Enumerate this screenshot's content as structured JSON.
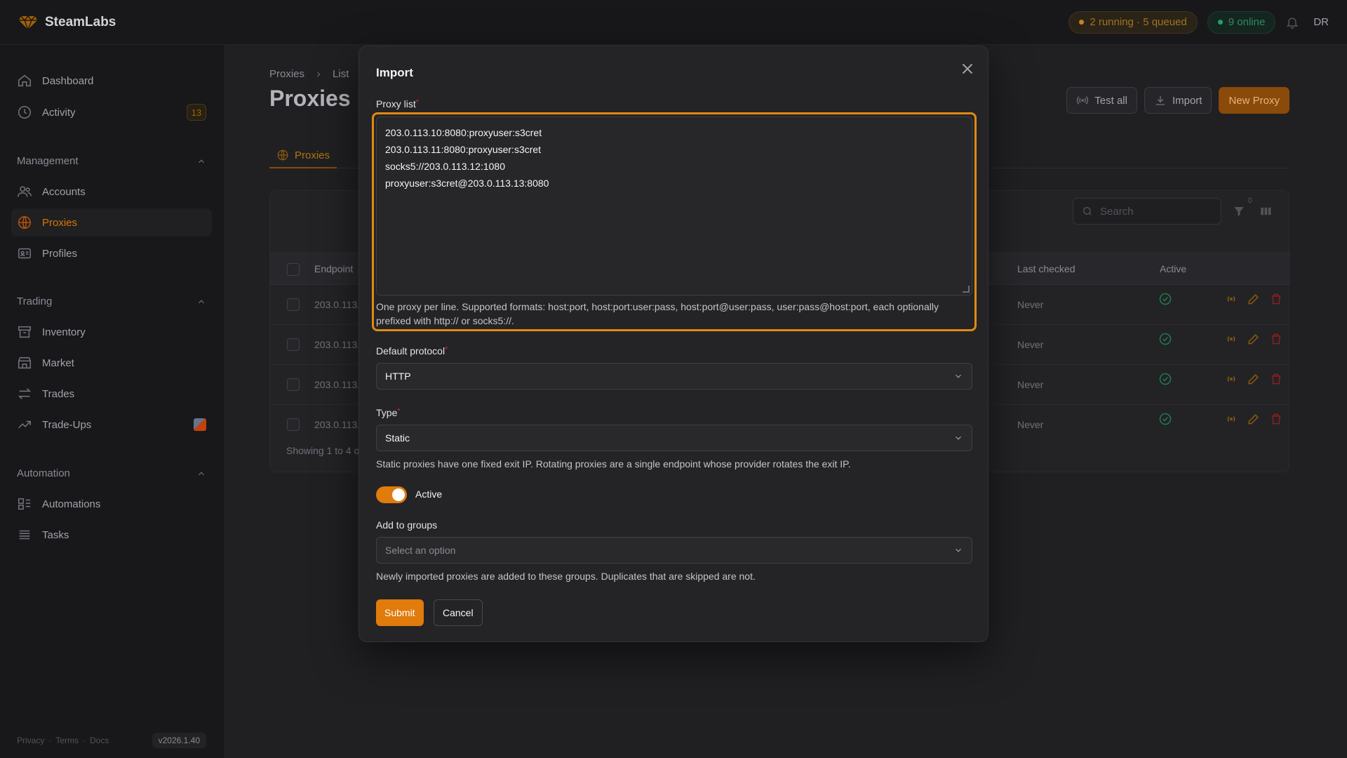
{
  "app": {
    "name": "SteamLabs"
  },
  "topbar": {
    "jobs_status": "2 running · 5 queued",
    "online_status": "9 online",
    "user_initials": "DR",
    "colors": {
      "running": "#c2851e",
      "online": "#22a06b"
    }
  },
  "sidebar": {
    "top": [
      {
        "label": "Dashboard",
        "icon": "home-icon"
      },
      {
        "label": "Activity",
        "icon": "clock-icon",
        "badge": "13"
      }
    ],
    "groups": [
      {
        "title": "Management",
        "items": [
          {
            "label": "Accounts",
            "icon": "users-icon"
          },
          {
            "label": "Proxies",
            "icon": "globe-icon",
            "active": true
          },
          {
            "label": "Profiles",
            "icon": "id-card-icon"
          }
        ]
      },
      {
        "title": "Trading",
        "items": [
          {
            "label": "Inventory",
            "icon": "archive-icon"
          },
          {
            "label": "Market",
            "icon": "store-icon"
          },
          {
            "label": "Trades",
            "icon": "arrows-icon"
          },
          {
            "label": "Trade-Ups",
            "icon": "trending-up-icon"
          }
        ]
      },
      {
        "title": "Automation",
        "items": [
          {
            "label": "Automations",
            "icon": "workflow-icon"
          },
          {
            "label": "Tasks",
            "icon": "list-icon"
          }
        ]
      }
    ],
    "footer": {
      "privacy": "Privacy",
      "terms": "Terms",
      "docs": "Docs",
      "version": "v2026.1.40"
    }
  },
  "page": {
    "breadcrumb": [
      "Proxies",
      "List"
    ],
    "title": "Proxies",
    "actions": {
      "test_all": "Test all",
      "import": "Import",
      "new": "New Proxy"
    },
    "tab": "Proxies",
    "search_placeholder": "Search",
    "filter_count": "0",
    "columns": {
      "endpoint": "Endpoint",
      "last_checked": "Last checked",
      "active": "Active"
    },
    "rows": [
      {
        "endpoint": "203.0.113.",
        "last_checked": "Never"
      },
      {
        "endpoint": "203.0.113.",
        "last_checked": "Never"
      },
      {
        "endpoint": "203.0.113.",
        "last_checked": "Never"
      },
      {
        "endpoint": "203.0.113.",
        "last_checked": "Never"
      }
    ],
    "showing": "Showing 1 to 4 o"
  },
  "modal": {
    "title": "Import",
    "proxy_list_label": "Proxy list",
    "proxy_list_value": [
      "203.0.113.10:8080:proxyuser:s3cret",
      "203.0.113.11:8080:proxyuser:s3cret",
      "socks5://203.0.113.12:1080",
      "proxyuser:s3cret@203.0.113.13:8080"
    ],
    "proxy_list_help": "One proxy per line. Supported formats: host:port, host:port:user:pass, host:port@user:pass, user:pass@host:port, each optionally prefixed with http:// or socks5://.",
    "protocol_label": "Default protocol",
    "protocol_value": "HTTP",
    "type_label": "Type",
    "type_value": "Static",
    "type_help": "Static proxies have one fixed exit IP. Rotating proxies are a single endpoint whose provider rotates the exit IP.",
    "active_label": "Active",
    "active_on": true,
    "groups_label": "Add to groups",
    "groups_placeholder": "Select an option",
    "groups_help": "Newly imported proxies are added to these groups. Duplicates that are skipped are not.",
    "submit": "Submit",
    "cancel": "Cancel",
    "accent": "#e07b0c"
  }
}
